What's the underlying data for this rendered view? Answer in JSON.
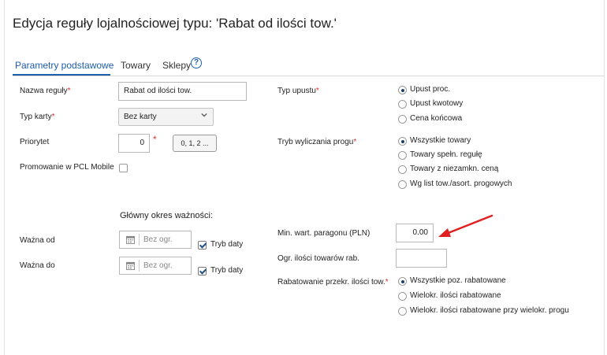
{
  "title": "Edycja reguły lojalnościowej typu: 'Rabat od ilości tow.'",
  "tabs": [
    {
      "label": "Parametry podstawowe",
      "active": true
    },
    {
      "label": "Towary",
      "active": false
    },
    {
      "label": "Sklepy",
      "active": false
    }
  ],
  "help_icon": "question-circle-icon",
  "left": {
    "name_label": "Nazwa reguły",
    "name_value": "Rabat od ilości tow.",
    "card_type_label": "Typ karty",
    "card_type_value": "Bez karty",
    "priority_label": "Priorytet",
    "priority_value": "0",
    "priority_button": "0, 1, 2 ...",
    "pcl_mobile_label": "Promowanie w PCL Mobile",
    "pcl_mobile_checked": false,
    "validity_heading": "Główny okres ważności:",
    "valid_from_label": "Ważna od",
    "valid_to_label": "Ważna do",
    "date_placeholder": "Bez ogr.",
    "date_mode_label": "Tryb daty",
    "date_mode_from_checked": true,
    "date_mode_to_checked": true
  },
  "right": {
    "discount_type_label": "Typ upustu",
    "discount_type_options": [
      {
        "label": "Upust proc.",
        "selected": true
      },
      {
        "label": "Upust kwotowy",
        "selected": false
      },
      {
        "label": "Cena końcowa",
        "selected": false
      }
    ],
    "threshold_mode_label": "Tryb wyliczania progu",
    "threshold_mode_options": [
      {
        "label": "Wszystkie towary",
        "selected": true
      },
      {
        "label": "Towary spełn. regułę",
        "selected": false
      },
      {
        "label": "Towary z niezamkn. ceną",
        "selected": false
      },
      {
        "label": "Wg list tow./asort. progowych",
        "selected": false
      }
    ],
    "min_receipt_label": "Min. wart. paragonu (PLN)",
    "min_receipt_value": "0.00",
    "qty_limit_label": "Ogr. ilości towarów rab.",
    "qty_limit_value": "",
    "rebate_exceed_label": "Rabatowanie przekr. ilości tow.",
    "rebate_exceed_options": [
      {
        "label": "Wszystkie poz. rabatowane",
        "selected": true
      },
      {
        "label": "Wielokr. ilości rabatowane",
        "selected": false
      },
      {
        "label": "Wielokr. ilości rabatowane przy wielokr. progu",
        "selected": false
      }
    ]
  },
  "colors": {
    "accent": "#1f5ea8",
    "required": "#d33333",
    "annotation_arrow": "#e02020"
  }
}
